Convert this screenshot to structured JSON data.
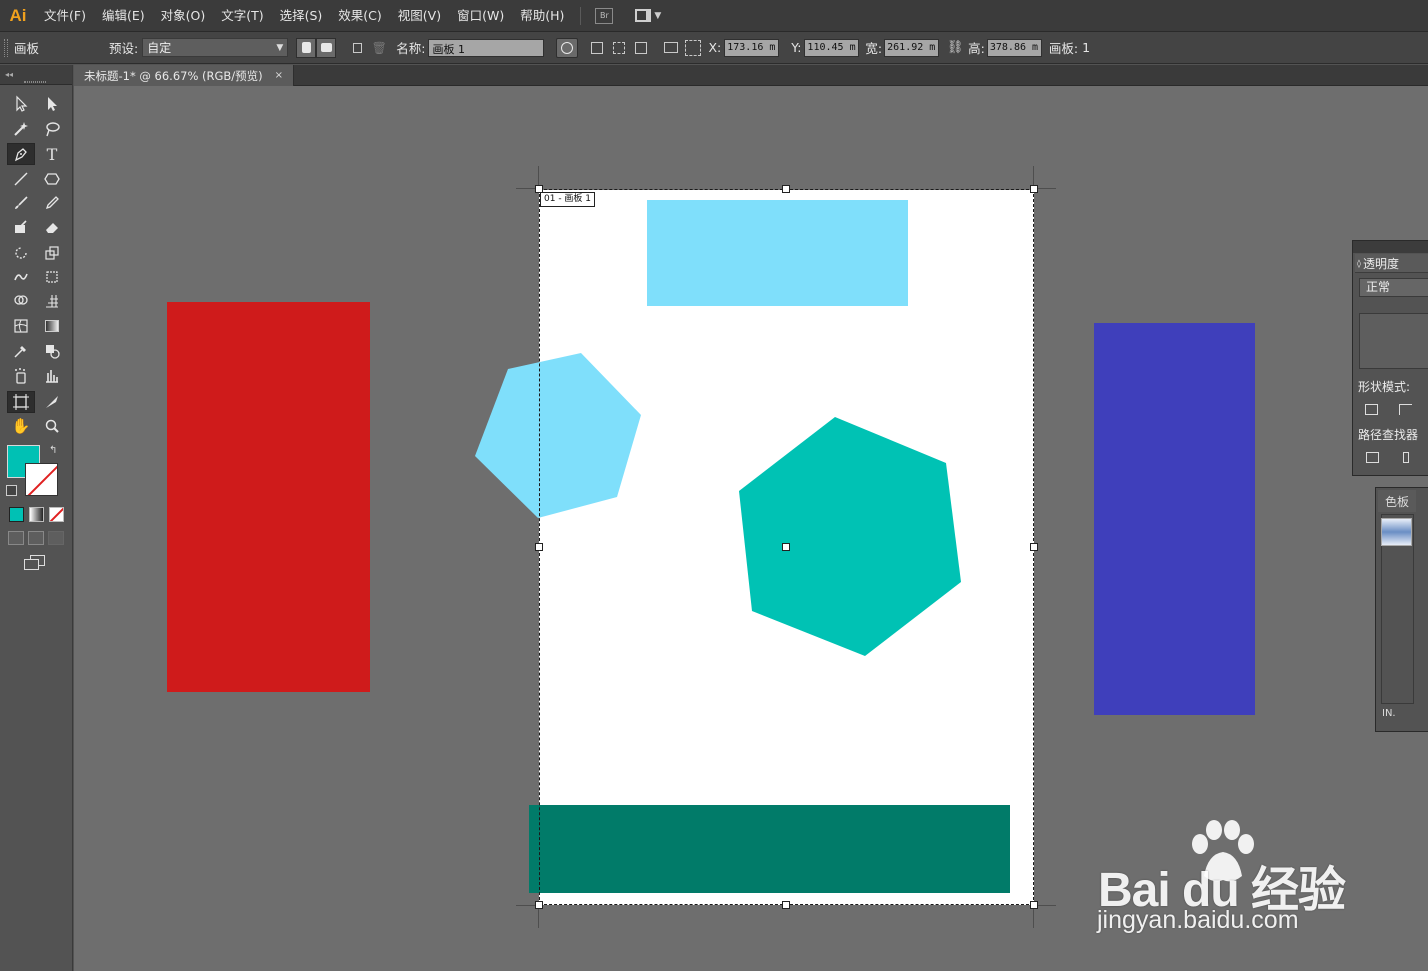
{
  "app": {
    "logo": "Ai"
  },
  "menu": [
    "文件(F)",
    "编辑(E)",
    "对象(O)",
    "文字(T)",
    "选择(S)",
    "效果(C)",
    "视图(V)",
    "窗口(W)",
    "帮助(H)"
  ],
  "menu_extras": {
    "bridge": "Br",
    "workspace_icon": "workspace-switcher-icon"
  },
  "control_bar": {
    "mode_label": "画板",
    "preset_label": "预设:",
    "preset_value": "自定",
    "name_label": "名称:",
    "name_value": "画板 1",
    "x_label": "X:",
    "x_value": "173.16 m",
    "y_label": "Y:",
    "y_value": "110.45 m",
    "w_label": "宽:",
    "w_value": "261.92 m",
    "h_label": "高:",
    "h_value": "378.86 m",
    "artboards_label": "画板:",
    "artboards_value": "1"
  },
  "document_tab": {
    "title": "未标题-1* @ 66.67% (RGB/预览)",
    "close": "×"
  },
  "tools_header": "◂◂",
  "fill_stroke": {
    "fill_color": "#00c1b4",
    "stroke": "none"
  },
  "artboard": {
    "label": "01 - 画板 1",
    "background": "#ffffff"
  },
  "canvas_shapes": {
    "red_rect_color": "#cf1b1b",
    "blue_rect_color": "#3f3fbb",
    "light_blue_color": "#7fdffb",
    "teal_color": "#00c2b4",
    "dark_teal_color": "#017b69"
  },
  "panels": {
    "transparency": {
      "tab": "透明度",
      "blend_mode": "正常",
      "shape_modes_label": "形状模式:",
      "pathfinder_label": "路径查找器"
    },
    "swatches": {
      "tab": "色板",
      "footer": "IN."
    }
  },
  "watermark": {
    "brand": "Bai  du 经验",
    "url": "jingyan.baidu.com"
  }
}
